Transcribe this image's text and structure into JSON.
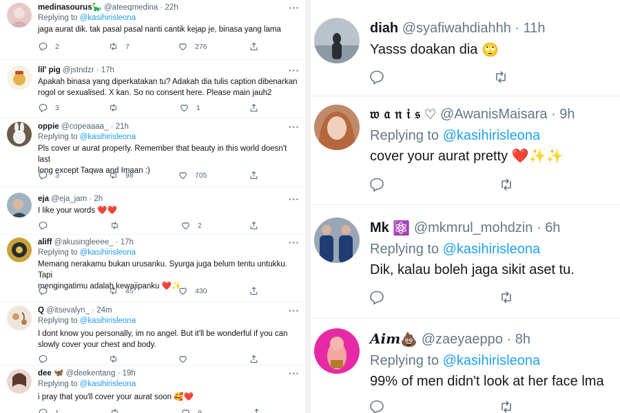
{
  "left_thread": {
    "tweets": [
      {
        "name": "medinasourus🦕",
        "handle": "@ateeqmedina",
        "time": "22h",
        "replying_label": "Replying to",
        "replying_to": "@kasihirisleona",
        "text": "jaga aurat dik. tak pasal pasal nanti cantik kejap je, binasa yang lama",
        "replies": "2",
        "retweets": "7",
        "likes": "276"
      },
      {
        "name": "lil' pig",
        "handle": "@jstndzr",
        "time": "17h",
        "text_lines": [
          "Apakah binasa yang diperkatakan tu? Adakah dia tulis caption dibenarkan",
          "rogol or sexualised. X kan. So no consent here. Please main jauh2"
        ],
        "replies": "3",
        "retweets": "",
        "likes": "1"
      },
      {
        "name": "oppie",
        "handle": "@copeaaaa_",
        "time": "21h",
        "replying_label": "Replying to",
        "replying_to": "@kasihirisleona",
        "text_lines": [
          "Pls cover ur aurat properly. Remember that beauty in this world doesn't last",
          "long except Taqwa and Imaan :)"
        ],
        "replies": "3",
        "retweets": "98",
        "likes": "705"
      },
      {
        "name": "eja",
        "handle": "@eja_jam",
        "time": "2h",
        "text": "I like your words",
        "emoji": "❤️❤️",
        "replies": "",
        "retweets": "",
        "likes": "2"
      },
      {
        "name": "aliff",
        "handle": "@akusingleeee_",
        "time": "17h",
        "replying_label": "Replying to",
        "replying_to": "@kasihirisleona",
        "text_lines": [
          "Memang nerakamu bukan urusanku. Syurga juga belum tentu untukku. Tapi",
          "mengingatimu adalah kewajipanku"
        ],
        "emoji": "❤️✨",
        "replies": "",
        "retweets": "45",
        "likes": "430"
      },
      {
        "name": "Q",
        "handle": "@itsevalyn_",
        "time": "24m",
        "replying_label": "Replying to",
        "replying_to": "@kasihirisleona",
        "text_lines": [
          "I dont know you personally, im no angel. But it'll be wonderful if you can",
          "slowly cover your chest and body."
        ],
        "replies": "",
        "retweets": "",
        "likes": ""
      },
      {
        "name": "dee",
        "name_emoji": "🦋",
        "handle": "@deekentang",
        "time": "19h",
        "replying_label": "Replying to",
        "replying_to": "@kasihirisleona",
        "text": "i pray that you'll cover your aurat soon",
        "emoji": "🥰❤️",
        "replies": "1",
        "retweets": "",
        "likes": "9"
      }
    ]
  },
  "right_thread": {
    "tweets": [
      {
        "name": "diah",
        "handle": "@syafiwahdiahhh",
        "time": "11h",
        "text": "Yasss doakan dia",
        "emoji": "🙄"
      },
      {
        "name": "𝔴 𝔞 𝔫 𝔦 𝔰",
        "name_emoji": "♡",
        "handle": "@AwanisMaisara",
        "time": "9h",
        "replying_label": "Replying to",
        "replying_to": "@kasihirisleona",
        "text": "cover your aurat pretty",
        "emoji": "❤️✨✨"
      },
      {
        "name": "Mk",
        "name_emoji": "⚛️",
        "handle": "@mkmrul_mohdzin",
        "time": "6h",
        "replying_label": "Replying to",
        "replying_to": "@kasihirisleona",
        "text": "Dik, kalau boleh jaga sikit aset tu."
      },
      {
        "name": "𝑨𝒊𝒎",
        "name_emoji": "💩",
        "handle": "@zaeyaeppo",
        "time": "8h",
        "replying_label": "Replying to",
        "replying_to": "@kasihirisleona",
        "text": "99% of men didn't look at her face lma"
      }
    ]
  },
  "colors": {
    "link": "#1d9bf0",
    "muted": "#536471",
    "heart": "#e0245e"
  },
  "icons": [
    "reply-icon",
    "retweet-icon",
    "like-icon",
    "share-icon",
    "more-icon"
  ]
}
